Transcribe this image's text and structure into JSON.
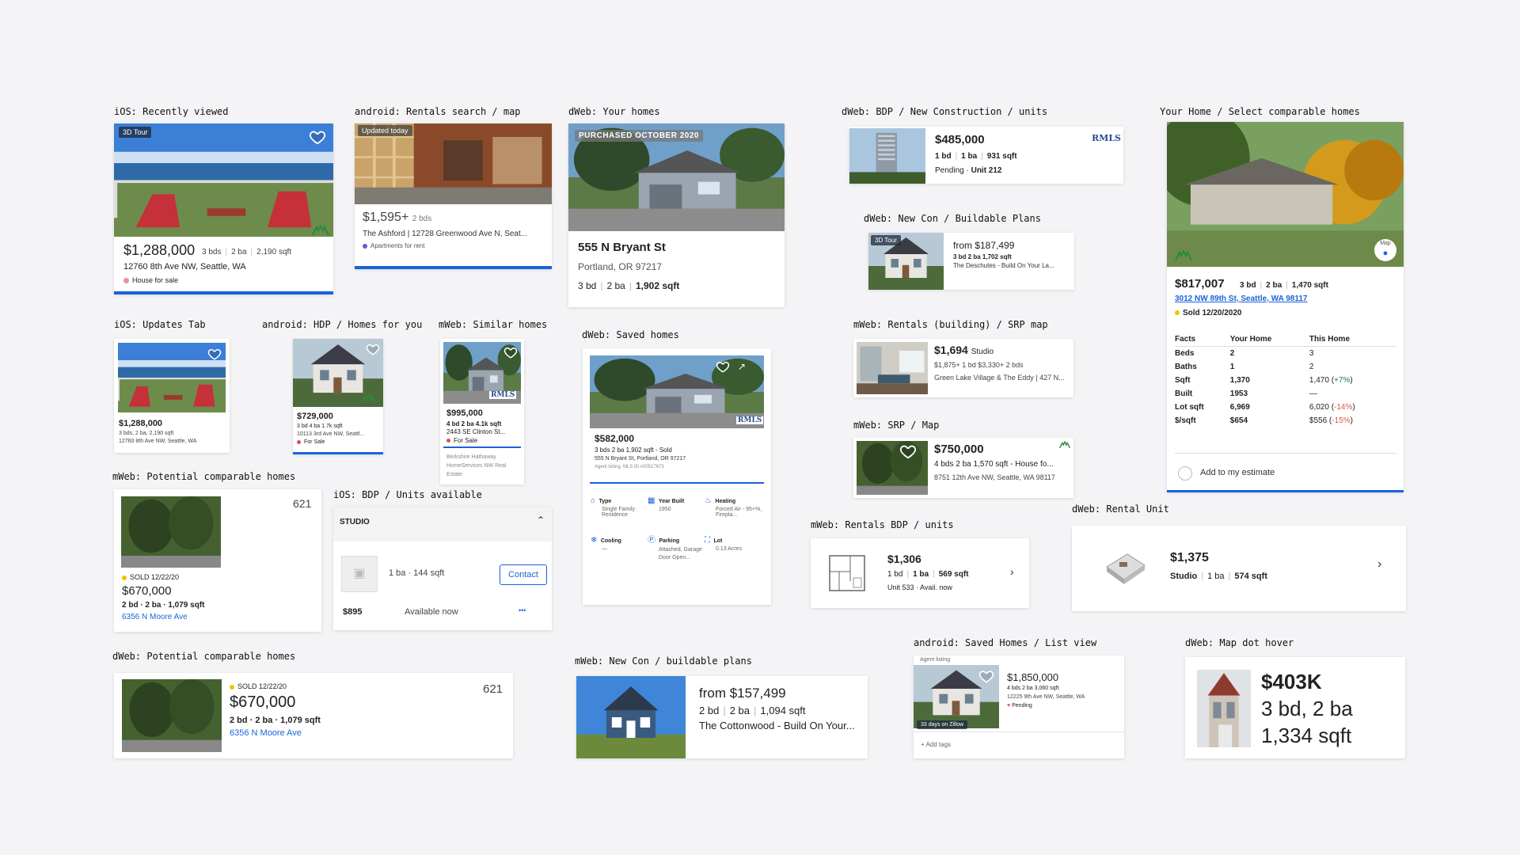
{
  "labels": {
    "ios_recent": "iOS: Recently viewed",
    "android_rentals": "android: Rentals search / map",
    "dweb_homes": "dWeb: Your homes",
    "dweb_bdp": "dWeb: BDP / New Construction / units",
    "your_home": "Your Home / Select comparable homes",
    "dweb_newcon": "dWeb: New Con / Buildable Plans",
    "ios_updates": "iOS: Updates Tab",
    "android_hdp": "android: HDP / Homes for you",
    "mweb_similar": "mWeb: Similar homes",
    "dweb_saved": "dWeb: Saved homes",
    "mweb_rentals_srp": "mWeb: Rentals (building) / SRP map",
    "mweb_srp": "mWeb: SRP / Map",
    "mweb_potential": "mWeb: Potential comparable homes",
    "ios_units": "iOS: BDP / Units available",
    "mweb_rentals_bdp": "mWeb: Rentals BDP / units",
    "dweb_rental_unit": "dWeb: Rental Unit",
    "dweb_potential": "dWeb: Potential comparable homes",
    "mweb_newcon": "mWeb: New Con / buildable plans",
    "android_saved": "android: Saved Homes / List view",
    "dweb_map": "dWeb: Map dot hover"
  },
  "ios_recent": {
    "tour": "3D Tour",
    "price": "$1,288,000",
    "beds": "3 bds",
    "baths": "2 ba",
    "sqft": "2,190 sqft",
    "addr": "12760 8th Ave NW, Seattle, WA",
    "status": "House for sale"
  },
  "android_rentals": {
    "badge": "Updated today",
    "price": "$1,595+",
    "beds": "2 bds",
    "addr": "The Ashford | 12728 Greenwood Ave N, Seat...",
    "status": "Apartments for rent"
  },
  "dweb_homes": {
    "badge": "PURCHASED OCTOBER 2020",
    "street": "555 N Bryant St",
    "city": "Portland, OR 97217",
    "beds": "3 bd",
    "baths": "2 ba",
    "sqft": "1,902 sqft"
  },
  "dweb_bdp": {
    "price": "$485,000",
    "beds": "1 bd",
    "baths": "1 ba",
    "sqft": "931 sqft",
    "status": "Pending · ",
    "unit": "Unit 212",
    "logo": "RMLS"
  },
  "dweb_newcon": {
    "tour": "3D Tour",
    "price": "from $187,499",
    "facts": "3 bd  2 ba  1,702 sqft",
    "name": "The Deschutes - Build On Your La..."
  },
  "your_home": {
    "map": "Map",
    "price": "$817,007",
    "beds": "3 bd",
    "baths": "2 ba",
    "sqft": "1,470 sqft",
    "addr": "3012 NW 89th St, Seattle, WA 98117",
    "sold": "Sold 12/20/2020",
    "headers": [
      "Facts",
      "Your Home",
      "This Home"
    ],
    "rows": [
      {
        "k": "Beds",
        "a": "2",
        "b": "3",
        "d": ""
      },
      {
        "k": "Baths",
        "a": "1",
        "b": "2",
        "d": ""
      },
      {
        "k": "Sqft",
        "a": "1,370",
        "b": "1,470 (",
        "d": "+7%"
      },
      {
        "k": "Built",
        "a": "1953",
        "b": "—",
        "d": ""
      },
      {
        "k": "Lot sqft",
        "a": "6,969",
        "b": "6,020 (",
        "d": "-14%"
      },
      {
        "k": "$/sqft",
        "a": "$654",
        "b": "$556 (",
        "d": "-15%"
      }
    ],
    "add": "Add to my estimate"
  },
  "ios_updates": {
    "price": "$1,288,000",
    "facts": "3 bds, 2 ba, 2,190 sqft",
    "addr": "12760 8th Ave NW, Seattle, WA"
  },
  "android_hdp": {
    "price": "$729,000",
    "facts": "3 bd  4 ba  1.7k sqft",
    "addr": "10113 3rd Ave NW, Seattl...",
    "status": "For Sale"
  },
  "mweb_similar": {
    "logo": "RMLS",
    "price": "$995,000",
    "facts": "4 bd  2 ba  4.1k sqft",
    "addr": "2443 SE Clinton St...",
    "status": "For Sale",
    "broker": "Berkshire Hathaway HomeServices NW Real Estate"
  },
  "dweb_saved": {
    "logo": "RMLS",
    "price": "$582,000",
    "facts": "3 bds  2 ba  1,902 sqft - Sold",
    "addr": "555 N Bryant St, Portland, OR 97217",
    "agent": "Agent listing. MLS ID #20517673",
    "details": [
      {
        "icon": "type-icon",
        "title": "Type",
        "value": "Single Family Residence"
      },
      {
        "icon": "calendar-icon",
        "title": "Year Built",
        "value": "1950"
      },
      {
        "icon": "heating-icon",
        "title": "Heating",
        "value": "Forced Air - 95+%, Firepla..."
      },
      {
        "icon": "snowflake-icon",
        "title": "Cooling",
        "value": "—"
      },
      {
        "icon": "parking-icon",
        "title": "Parking",
        "value": "Attached, Garage Door Open..."
      },
      {
        "icon": "lot-icon",
        "title": "Lot",
        "value": "0.13 Acres"
      }
    ]
  },
  "mweb_rentals_srp": {
    "price": "$1,694",
    "beds": "Studio",
    "more": "$1,875+ 1 bd  $3,330+ 2 bds",
    "name": "Green Lake Village & The Eddy | 427 N..."
  },
  "mweb_srp": {
    "price": "$750,000",
    "facts": "4 bds  2 ba  1,570 sqft - House fo...",
    "addr": "8751 12th Ave NW, Seattle, WA 98117"
  },
  "mweb_potential": {
    "count": "621",
    "sold": "SOLD 12/22/20",
    "price": "$670,000",
    "facts": "2 bd · 2 ba · 1,079 sqft",
    "addr": "6356 N Moore Ave"
  },
  "ios_units": {
    "section": "STUDIO",
    "facts": "1 ba · 144 sqft",
    "contact": "Contact",
    "price": "$895",
    "avail": "Available now",
    "more": "•••"
  },
  "mweb_rentals_bdp": {
    "price": "$1,306",
    "beds": "1 bd",
    "baths": "1 ba",
    "sqft": "569 sqft",
    "unit": "Unit 533 · Avail. now"
  },
  "dweb_rental_unit": {
    "price": "$1,375",
    "beds": "Studio",
    "baths": "1 ba",
    "sqft": "574 sqft"
  },
  "dweb_potential": {
    "count": "621",
    "sold": "SOLD 12/22/20",
    "price": "$670,000",
    "facts": "2 bd · 2 ba · 1,079 sqft",
    "addr": "6356 N Moore Ave"
  },
  "mweb_newcon": {
    "price": "from $157,499",
    "beds": "2 bd",
    "baths": "2 ba",
    "sqft": "1,094 sqft",
    "name": "The Cottonwood - Build On Your..."
  },
  "android_saved": {
    "agent": "Agent listing",
    "days": "33 days on Zillow",
    "price": "$1,850,000",
    "facts": "4 bds  2 ba  3,060 sqft",
    "addr": "12225 9th Ave NW, Seattle, WA",
    "status": "Pending",
    "tags": "+ Add tags"
  },
  "dweb_map": {
    "price": "$403K",
    "bdba": "3 bd, 2 ba",
    "sqft": "1,334 sqft"
  },
  "colors": {
    "blue": "#1a63d8",
    "red": "#d9534f",
    "purple": "#7b4fd1",
    "yellow": "#f2c200",
    "green": "#0a8a3a",
    "zillow_green": "#2b8a3e"
  }
}
